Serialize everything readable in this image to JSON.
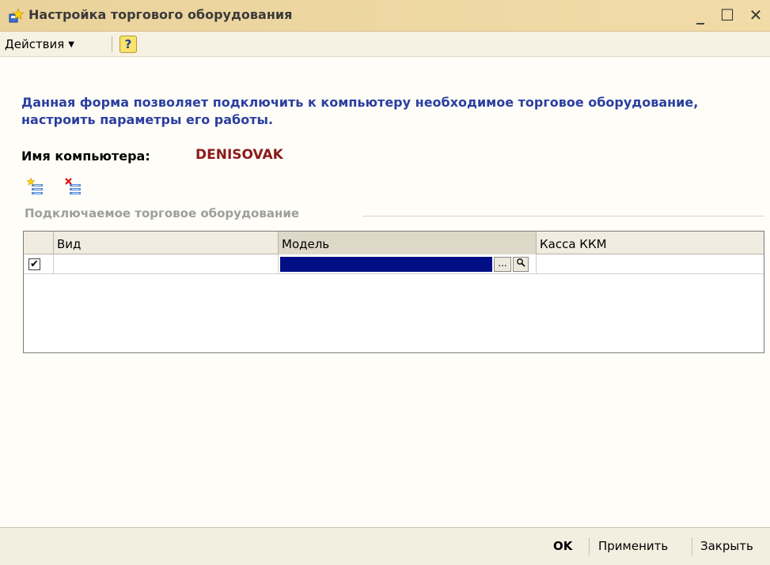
{
  "window": {
    "title": "Настройка торгового оборудования",
    "minimize_glyph": "_",
    "maximize_glyph": "☐",
    "close_glyph": "✕"
  },
  "toolbar": {
    "actions_label": "Действия",
    "help_label": "?"
  },
  "content": {
    "description": "Данная форма позволяет подключить к компьютеру необходимое торговое оборудование, настроить параметры его работы.",
    "computer_name_label": "Имя компьютера:",
    "computer_name_value": "DENISOVAK",
    "group_title": "Подключаемое торговое оборудование"
  },
  "table": {
    "columns": [
      "",
      "Вид",
      "Модель",
      "Касса ККМ"
    ],
    "rows": [
      {
        "checked": true,
        "check_glyph": "✔",
        "vid": "",
        "model": "",
        "kassa": ""
      }
    ],
    "select_button": "...",
    "search_glyph": "🔍"
  },
  "footer": {
    "ok_label": "OK",
    "apply_label": "Применить",
    "close_label": "Закрыть"
  },
  "colors": {
    "title_bar": "#ead29b",
    "description_text": "#2b3fa0",
    "computer_name_value": "#8b1a1a",
    "selected_field": "#000f85"
  }
}
